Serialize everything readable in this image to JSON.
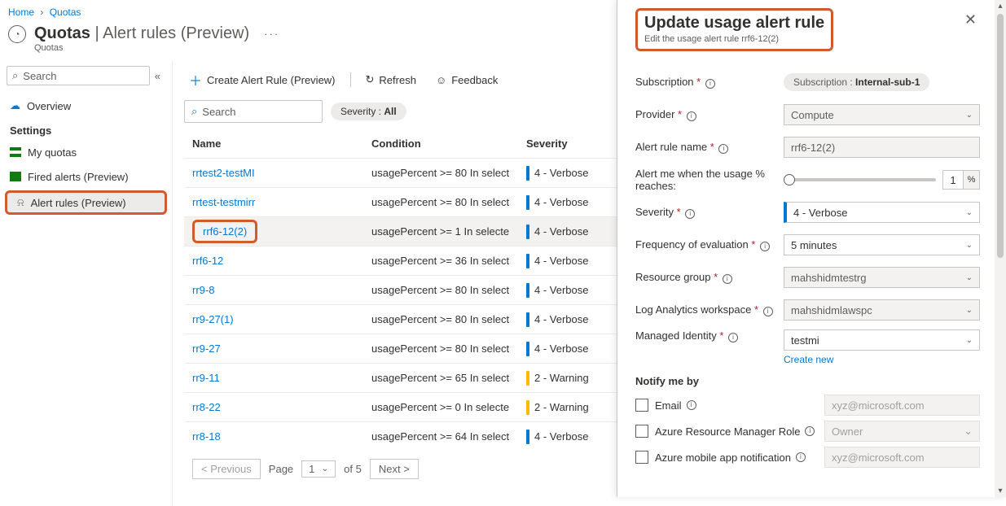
{
  "breadcrumb": {
    "home": "Home",
    "quotas": "Quotas"
  },
  "header": {
    "title": "Quotas",
    "subtitle": "Alert rules (Preview)",
    "small": "Quotas",
    "dots": "···"
  },
  "sidebar": {
    "search_placeholder": "Search",
    "overview": "Overview",
    "settings_label": "Settings",
    "items": [
      {
        "label": "My quotas"
      },
      {
        "label": "Fired alerts (Preview)"
      },
      {
        "label": "Alert rules (Preview)"
      }
    ]
  },
  "toolbar": {
    "create": "Create Alert Rule (Preview)",
    "refresh": "Refresh",
    "feedback": "Feedback"
  },
  "filter": {
    "search_placeholder": "Search",
    "severity_label": "Severity :",
    "severity_value": "All"
  },
  "columns": {
    "name": "Name",
    "condition": "Condition",
    "severity": "Severity"
  },
  "rows": [
    {
      "name": "rrtest2-testMI",
      "condition": "usagePercent >= 80 In select",
      "severity": "4 - Verbose",
      "color": "blue"
    },
    {
      "name": "rrtest-testmirr",
      "condition": "usagePercent >= 80 In select",
      "severity": "4 - Verbose",
      "color": "blue"
    },
    {
      "name": "rrf6-12(2)",
      "condition": "usagePercent >= 1 In selecte",
      "severity": "4 - Verbose",
      "color": "blue",
      "selected": true,
      "highlight": true
    },
    {
      "name": "rrf6-12",
      "condition": "usagePercent >= 36 In select",
      "severity": "4 - Verbose",
      "color": "blue"
    },
    {
      "name": "rr9-8",
      "condition": "usagePercent >= 80 In select",
      "severity": "4 - Verbose",
      "color": "blue"
    },
    {
      "name": "rr9-27(1)",
      "condition": "usagePercent >= 80 In select",
      "severity": "4 - Verbose",
      "color": "blue"
    },
    {
      "name": "rr9-27",
      "condition": "usagePercent >= 80 In select",
      "severity": "4 - Verbose",
      "color": "blue"
    },
    {
      "name": "rr9-11",
      "condition": "usagePercent >= 65 In select",
      "severity": "2 - Warning",
      "color": "yellow"
    },
    {
      "name": "rr8-22",
      "condition": "usagePercent >= 0 In selecte",
      "severity": "2 - Warning",
      "color": "yellow"
    },
    {
      "name": "rr8-18",
      "condition": "usagePercent >= 64 In select",
      "severity": "4 - Verbose",
      "color": "blue"
    }
  ],
  "pager": {
    "prev": "< Previous",
    "page_label": "Page",
    "page_value": "1",
    "of_label": "of 5",
    "next": "Next >"
  },
  "panel": {
    "title": "Update usage alert rule",
    "subtitle": "Edit the usage alert rule rrf6-12(2)",
    "labels": {
      "subscription": "Subscription",
      "provider": "Provider",
      "alert_name": "Alert rule name",
      "alert_usage": "Alert me when the usage % reaches:",
      "severity": "Severity",
      "frequency": "Frequency of evaluation",
      "rg": "Resource group",
      "law": "Log Analytics workspace",
      "mi": "Managed Identity",
      "create_new": "Create new",
      "notify": "Notify me by",
      "email": "Email",
      "arm": "Azure Resource Manager Role",
      "mobile": "Azure mobile app notification"
    },
    "values": {
      "subscription_key": "Subscription :",
      "subscription_val": "Internal-sub-1",
      "provider": "Compute",
      "alert_name": "rrf6-12(2)",
      "slider_val": "1",
      "slider_unit": "%",
      "severity": "4 - Verbose",
      "frequency": "5 minutes",
      "rg": "mahshidmtestrg",
      "law": "mahshidmlawspc",
      "mi": "testmi",
      "email_ph": "xyz@microsoft.com",
      "arm_ph": "Owner",
      "mobile_ph": "xyz@microsoft.com"
    }
  }
}
